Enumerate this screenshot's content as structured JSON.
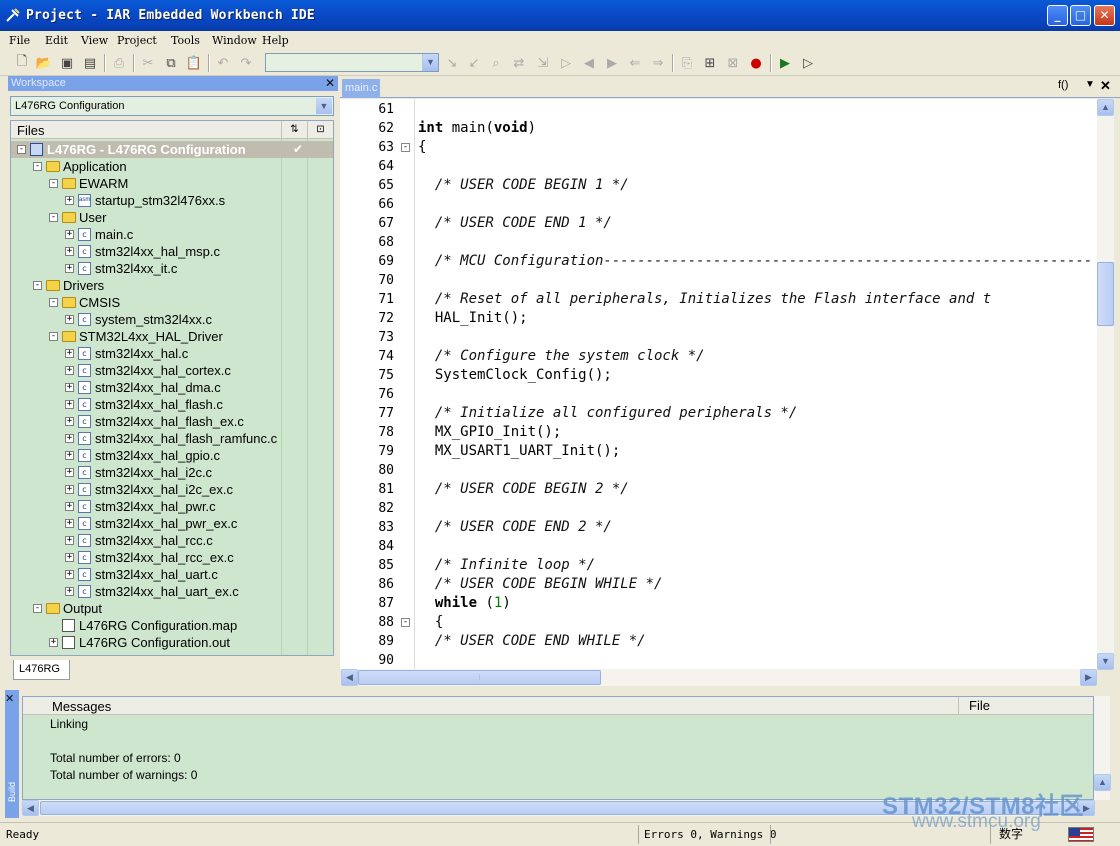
{
  "window": {
    "title": "Project - IAR Embedded Workbench IDE",
    "minimize": "_",
    "maximize": "□",
    "close": "✕"
  },
  "menu": [
    "File",
    "Edit",
    "View",
    "Project",
    "Tools",
    "Window",
    "Help"
  ],
  "toolbar": {
    "combo_value": ""
  },
  "workspace": {
    "title": "Workspace",
    "configuration": "L476RG Configuration",
    "files_header": "Files",
    "tab": "L476RG",
    "tree": [
      {
        "label": "L476RG - L476RG Configuration",
        "icon": "project-icon",
        "depth": 0,
        "exp": "-",
        "selected": true,
        "check": "✔"
      },
      {
        "label": "Application",
        "icon": "folder-icon",
        "depth": 1,
        "exp": "-"
      },
      {
        "label": "EWARM",
        "icon": "folder-icon",
        "depth": 2,
        "exp": "-"
      },
      {
        "label": "startup_stm32l476xx.s",
        "icon": "asm-file-icon",
        "depth": 3,
        "exp": "+"
      },
      {
        "label": "User",
        "icon": "folder-icon",
        "depth": 2,
        "exp": "-"
      },
      {
        "label": "main.c",
        "icon": "c-file-icon",
        "depth": 3,
        "exp": "+"
      },
      {
        "label": "stm32l4xx_hal_msp.c",
        "icon": "c-file-icon",
        "depth": 3,
        "exp": "+"
      },
      {
        "label": "stm32l4xx_it.c",
        "icon": "c-file-icon",
        "depth": 3,
        "exp": "+"
      },
      {
        "label": "Drivers",
        "icon": "folder-icon",
        "depth": 1,
        "exp": "-"
      },
      {
        "label": "CMSIS",
        "icon": "folder-icon",
        "depth": 2,
        "exp": "-"
      },
      {
        "label": "system_stm32l4xx.c",
        "icon": "c-file-icon",
        "depth": 3,
        "exp": "+"
      },
      {
        "label": "STM32L4xx_HAL_Driver",
        "icon": "folder-icon",
        "depth": 2,
        "exp": "-"
      },
      {
        "label": "stm32l4xx_hal.c",
        "icon": "c-file-icon",
        "depth": 3,
        "exp": "+"
      },
      {
        "label": "stm32l4xx_hal_cortex.c",
        "icon": "c-file-icon",
        "depth": 3,
        "exp": "+"
      },
      {
        "label": "stm32l4xx_hal_dma.c",
        "icon": "c-file-icon",
        "depth": 3,
        "exp": "+"
      },
      {
        "label": "stm32l4xx_hal_flash.c",
        "icon": "c-file-icon",
        "depth": 3,
        "exp": "+"
      },
      {
        "label": "stm32l4xx_hal_flash_ex.c",
        "icon": "c-file-icon",
        "depth": 3,
        "exp": "+"
      },
      {
        "label": "stm32l4xx_hal_flash_ramfunc.c",
        "icon": "c-file-icon",
        "depth": 3,
        "exp": "+"
      },
      {
        "label": "stm32l4xx_hal_gpio.c",
        "icon": "c-file-icon",
        "depth": 3,
        "exp": "+"
      },
      {
        "label": "stm32l4xx_hal_i2c.c",
        "icon": "c-file-icon",
        "depth": 3,
        "exp": "+"
      },
      {
        "label": "stm32l4xx_hal_i2c_ex.c",
        "icon": "c-file-icon",
        "depth": 3,
        "exp": "+"
      },
      {
        "label": "stm32l4xx_hal_pwr.c",
        "icon": "c-file-icon",
        "depth": 3,
        "exp": "+"
      },
      {
        "label": "stm32l4xx_hal_pwr_ex.c",
        "icon": "c-file-icon",
        "depth": 3,
        "exp": "+"
      },
      {
        "label": "stm32l4xx_hal_rcc.c",
        "icon": "c-file-icon",
        "depth": 3,
        "exp": "+"
      },
      {
        "label": "stm32l4xx_hal_rcc_ex.c",
        "icon": "c-file-icon",
        "depth": 3,
        "exp": "+"
      },
      {
        "label": "stm32l4xx_hal_uart.c",
        "icon": "c-file-icon",
        "depth": 3,
        "exp": "+"
      },
      {
        "label": "stm32l4xx_hal_uart_ex.c",
        "icon": "c-file-icon",
        "depth": 3,
        "exp": "+"
      },
      {
        "label": "Output",
        "icon": "folder-icon",
        "depth": 1,
        "exp": "-"
      },
      {
        "label": "L476RG Configuration.map",
        "icon": "document-icon",
        "depth": 2,
        "exp": ""
      },
      {
        "label": "L476RG Configuration.out",
        "icon": "document-icon",
        "depth": 2,
        "exp": "+"
      }
    ]
  },
  "editor": {
    "tab": "main.c",
    "function_label": "f()",
    "lines": [
      {
        "n": "61",
        "text": "",
        "fold": ""
      },
      {
        "n": "62",
        "text": "int main(void)",
        "fold": ""
      },
      {
        "n": "63",
        "text": "{",
        "fold": "-"
      },
      {
        "n": "64",
        "text": "",
        "fold": ""
      },
      {
        "n": "65",
        "text": "  /* USER CODE BEGIN 1 */",
        "fold": ""
      },
      {
        "n": "66",
        "text": "",
        "fold": ""
      },
      {
        "n": "67",
        "text": "  /* USER CODE END 1 */",
        "fold": ""
      },
      {
        "n": "68",
        "text": "",
        "fold": ""
      },
      {
        "n": "69",
        "text": "  /* MCU Configuration----------------------------------------------------------",
        "fold": ""
      },
      {
        "n": "70",
        "text": "",
        "fold": ""
      },
      {
        "n": "71",
        "text": "  /* Reset of all peripherals, Initializes the Flash interface and t",
        "fold": ""
      },
      {
        "n": "72",
        "text": "  HAL_Init();",
        "fold": ""
      },
      {
        "n": "73",
        "text": "",
        "fold": ""
      },
      {
        "n": "74",
        "text": "  /* Configure the system clock */",
        "fold": ""
      },
      {
        "n": "75",
        "text": "  SystemClock_Config();",
        "fold": ""
      },
      {
        "n": "76",
        "text": "",
        "fold": ""
      },
      {
        "n": "77",
        "text": "  /* Initialize all configured peripherals */",
        "fold": ""
      },
      {
        "n": "78",
        "text": "  MX_GPIO_Init();",
        "fold": ""
      },
      {
        "n": "79",
        "text": "  MX_USART1_UART_Init();",
        "fold": ""
      },
      {
        "n": "80",
        "text": "",
        "fold": ""
      },
      {
        "n": "81",
        "text": "  /* USER CODE BEGIN 2 */",
        "fold": ""
      },
      {
        "n": "82",
        "text": "",
        "fold": ""
      },
      {
        "n": "83",
        "text": "  /* USER CODE END 2 */",
        "fold": ""
      },
      {
        "n": "84",
        "text": "",
        "fold": ""
      },
      {
        "n": "85",
        "text": "  /* Infinite loop */",
        "fold": ""
      },
      {
        "n": "86",
        "text": "  /* USER CODE BEGIN WHILE */",
        "fold": ""
      },
      {
        "n": "87",
        "text": "  while (1)",
        "fold": ""
      },
      {
        "n": "88",
        "text": "  {",
        "fold": "-"
      },
      {
        "n": "89",
        "text": "  /* USER CODE END WHILE */",
        "fold": ""
      },
      {
        "n": "90",
        "text": "",
        "fold": ""
      }
    ]
  },
  "build": {
    "side_label": "Build",
    "messages_header": "Messages",
    "file_header": "File",
    "messages": [
      "Linking",
      "",
      "Total number of errors: 0",
      "Total number of warnings: 0"
    ]
  },
  "status": {
    "ready": "Ready",
    "errors": "Errors 0, Warnings 0",
    "ime": "数字"
  },
  "watermark": {
    "line1": "STM32/STM8社区",
    "line2": "www.stmcu.org"
  }
}
